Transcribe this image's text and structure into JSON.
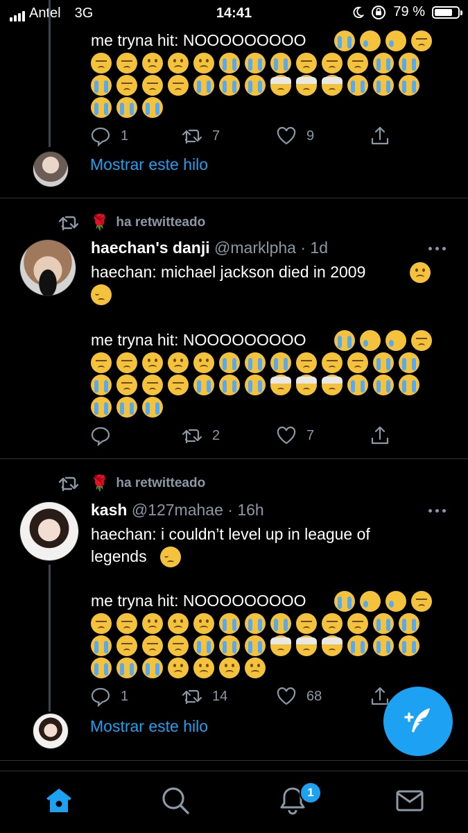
{
  "status_bar": {
    "carrier": "Antel",
    "network": "3G",
    "time": "14:41",
    "battery_percent": "79 %",
    "battery_level": 0.79
  },
  "tweets": [
    {
      "text_line": "me tryna hit: NOOOOOOOOO",
      "emojis": [
        "sob",
        "cry",
        "cry",
        "dis",
        "dis",
        "dis",
        "frown",
        "frown",
        "frown",
        "sob",
        "sob",
        "sob",
        "dis",
        "dis",
        "dis",
        "sob",
        "sob",
        "sob",
        "dis",
        "dis",
        "dis",
        "sob",
        "sob",
        "sob",
        "band",
        "band",
        "band",
        "sob",
        "sob",
        "sob",
        "sob",
        "sob",
        "sob"
      ],
      "replies": "1",
      "retweets": "7",
      "likes": "9",
      "show_thread": "Mostrar este hilo"
    },
    {
      "retweet_label": "ha retwitteado",
      "retweet_emoji": "🌹",
      "name": "haechan's danji",
      "handle": "@marklpha",
      "time": "· 1d",
      "text_line1": "haechan: michael jackson died in 2009",
      "text_line2": "me tryna hit: NOOOOOOOOO",
      "emojis": [
        "sob",
        "cry",
        "cry",
        "dis",
        "dis",
        "dis",
        "frown",
        "frown",
        "frown",
        "sob",
        "sob",
        "sob",
        "dis",
        "dis",
        "dis",
        "sob",
        "sob",
        "sob",
        "dis",
        "dis",
        "dis",
        "sob",
        "sob",
        "sob",
        "band",
        "band",
        "band",
        "sob",
        "sob",
        "sob",
        "sob",
        "sob",
        "sob"
      ],
      "replies": "",
      "retweets": "2",
      "likes": "7"
    },
    {
      "retweet_label": "ha retwitteado",
      "retweet_emoji": "🌹",
      "name": "kash",
      "handle": "@127mahae",
      "time": "· 16h",
      "text_line1": "haechan: i couldn’t level up in league of",
      "text_line1b": "legends",
      "text_line2": "me tryna hit: NOOOOOOOOO",
      "emojis": [
        "sob",
        "cry",
        "cry",
        "dis",
        "dis",
        "dis",
        "frown",
        "frown",
        "frown",
        "sob",
        "sob",
        "sob",
        "dis",
        "dis",
        "dis",
        "sob",
        "sob",
        "sob",
        "dis",
        "dis",
        "dis",
        "sob",
        "sob",
        "sob",
        "band",
        "band",
        "band",
        "sob",
        "sob",
        "sob",
        "sob",
        "sob",
        "sob",
        "frown",
        "frown",
        "frown",
        "frown"
      ],
      "replies": "1",
      "retweets": "14",
      "likes": "68",
      "show_thread": "Mostrar este hilo"
    }
  ],
  "tabbar": {
    "notifications_badge": "1"
  },
  "colors": {
    "accent": "#1da1f2",
    "secondary_text": "#8b98a5",
    "divider": "#2f3336"
  }
}
